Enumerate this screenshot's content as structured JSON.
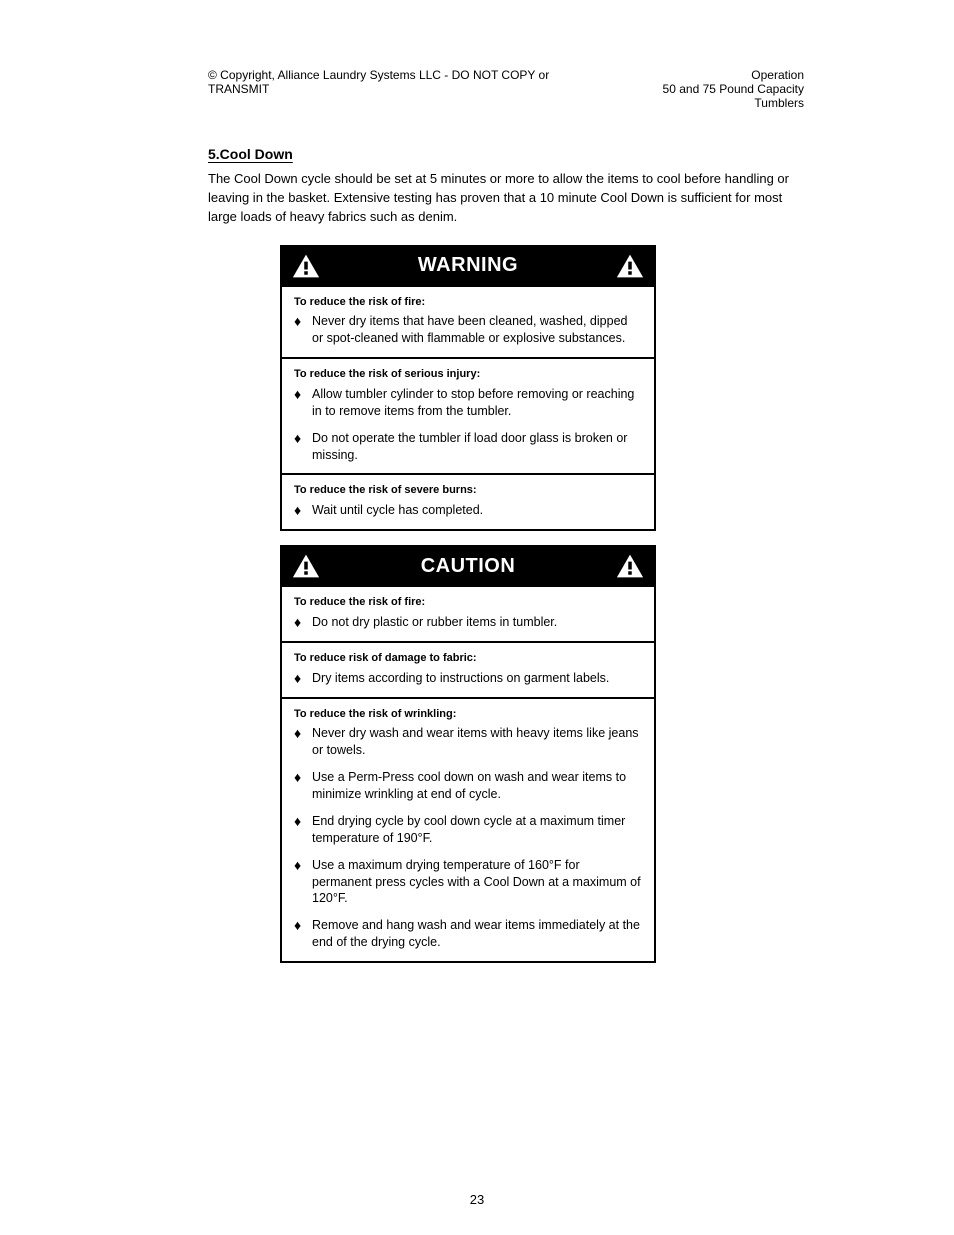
{
  "header": {
    "left": "© Copyright, Alliance Laundry Systems LLC - DO NOT COPY or TRANSMIT",
    "right_line1": "Operation",
    "right_line2": "50 and 75 Pound Capacity Tumblers"
  },
  "section_title": "5.Cool Down",
  "lead": "The Cool Down cycle should be set at 5 minutes or more to allow the items to cool before handling or leaving in the basket. Extensive testing has proven that a 10 minute Cool Down is sufficient for most large loads of heavy fabrics such as denim.",
  "warning": {
    "label": "WARNING",
    "cells": [
      {
        "sub": "To reduce the risk of fire:",
        "rows": [
          {
            "text": "Never dry items that have been cleaned, washed, dipped or spot-cleaned with flammable or explosive substances."
          }
        ]
      },
      {
        "sub": "To reduce the risk of serious injury:",
        "rows": [
          {
            "text": "Allow tumbler cylinder to stop before removing or reaching in to remove items from the tumbler."
          },
          {
            "text": "Do not operate the tumbler if load door glass is broken or missing."
          }
        ]
      },
      {
        "sub": "To reduce the risk of severe burns:",
        "rows": [
          {
            "text": "Wait until cycle has completed."
          }
        ]
      }
    ]
  },
  "caution": {
    "label": "CAUTION",
    "cells": [
      {
        "sub": "To reduce the risk of fire:",
        "rows": [
          {
            "text": "Do not dry plastic or rubber items in tumbler."
          }
        ]
      },
      {
        "sub": "To reduce risk of damage to fabric:",
        "rows": [
          {
            "text": "Dry items according to instructions on garment labels."
          }
        ]
      },
      {
        "sub": "To reduce the risk of wrinkling:",
        "rows": [
          {
            "text": "Never dry wash and wear items with heavy items like jeans or towels."
          },
          {
            "text": "Use a Perm-Press cool down on wash and wear items to minimize wrinkling at end of cycle."
          },
          {
            "text": "End drying cycle by cool down cycle at a maximum timer temperature of 190°F."
          },
          {
            "text": "Use a maximum drying temperature of 160°F for permanent press cycles with a Cool Down at a maximum of 120°F."
          },
          {
            "text": "Remove and hang wash and wear items immediately at the end of the drying cycle."
          }
        ]
      }
    ]
  },
  "page_number": "23"
}
